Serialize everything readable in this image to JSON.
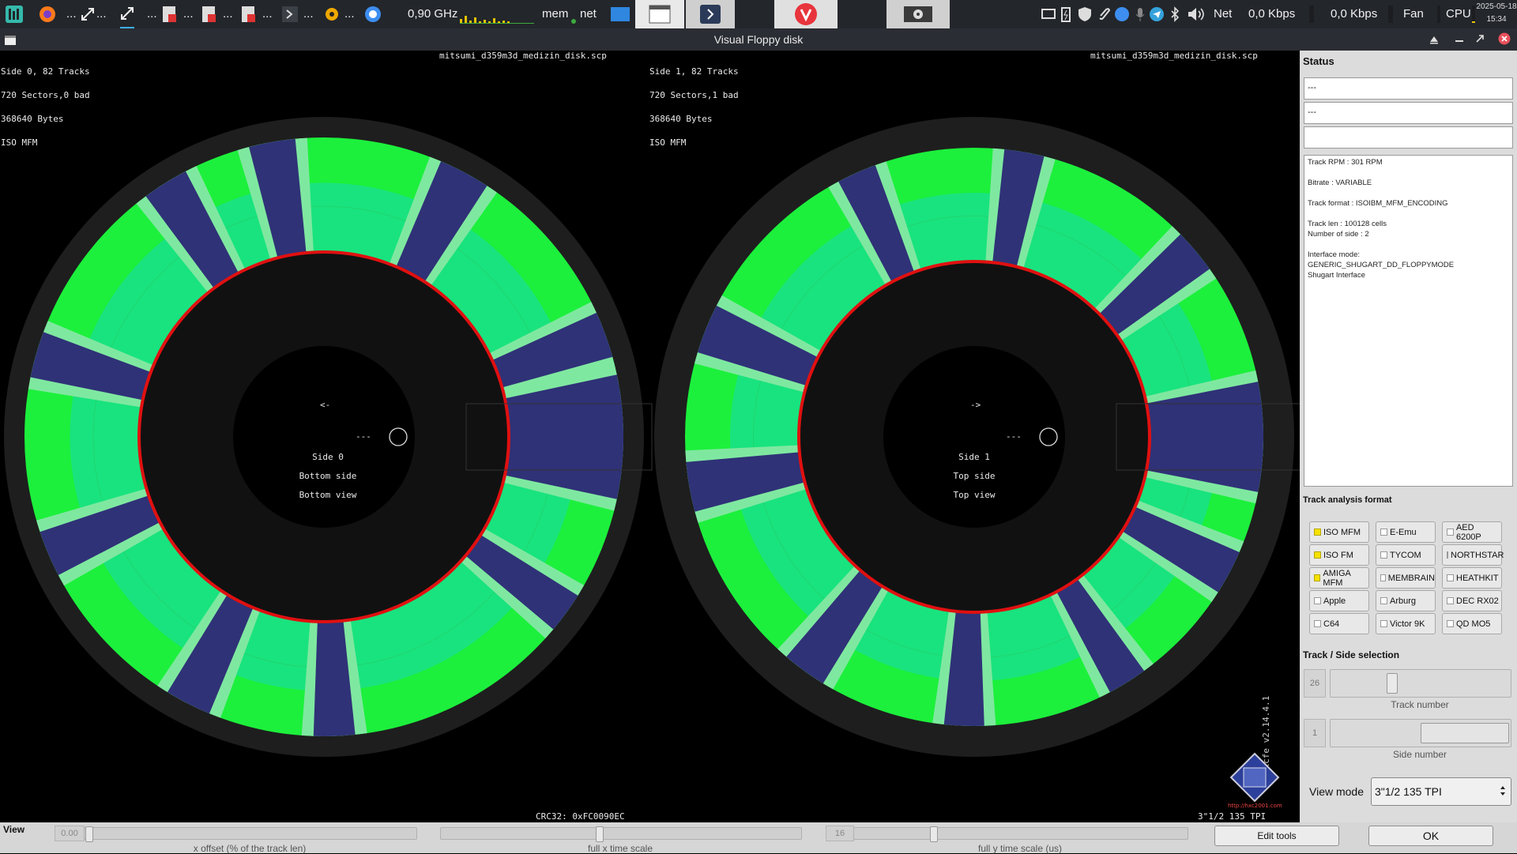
{
  "taskbar": {
    "cpu_freq": "0,90 GHz",
    "mem_label": "mem",
    "net_label": "net",
    "net_text": "Net",
    "net_down": "0,0 Kbps",
    "net_up": "0,0 Kbps",
    "fan_label": "Fan",
    "cpu_label": "CPU",
    "date": "2025-05-18",
    "time": "15:34",
    "ellipsis": "..."
  },
  "window": {
    "title": "Visual Floppy disk"
  },
  "side0": {
    "info_lines": [
      "Side 0, 82 Tracks",
      "720 Sectors,0 bad",
      "368640 Bytes",
      "ISO MFM"
    ],
    "filename": "mitsumi_d359m3d_medizin_disk.scp",
    "center_lines": [
      "Side 0",
      "Bottom side",
      "Bottom view"
    ],
    "arrow": "<-",
    "dashes": "---"
  },
  "side1": {
    "info_lines": [
      "Side 1, 82 Tracks",
      "720 Sectors,1 bad",
      "368640 Bytes",
      "ISO MFM"
    ],
    "filename": "mitsumi_d359m3d_medizin_disk.scp",
    "center_lines": [
      "Side 1",
      "Top side",
      "Top view"
    ],
    "arrow": "->",
    "dashes": "---"
  },
  "crc": "CRC32: 0xFC0090EC",
  "tpi_label": "3\"1/2 135 TPI",
  "lib_version": "libhxcfe v2.14.4.1",
  "logo_url": "http://hxc2001.com",
  "logo_text": "HxC2001",
  "status": {
    "heading": "Status",
    "field1": "---",
    "field2": "---",
    "field3": "",
    "info": [
      "Track RPM : 301 RPM",
      "",
      "Bitrate : VARIABLE",
      "",
      "Track format : ISOIBM_MFM_ENCODING",
      "",
      "Track len : 100128 cells",
      "Number of side : 2",
      "",
      "Interface mode:",
      "GENERIC_SHUGART_DD_FLOPPYMODE",
      "Shugart Interface"
    ]
  },
  "analysis": {
    "heading": "Track analysis format",
    "formats": [
      {
        "label": "ISO MFM",
        "checked": true
      },
      {
        "label": "E-Emu",
        "checked": false
      },
      {
        "label": "AED 6200P",
        "checked": false
      },
      {
        "label": "ISO FM",
        "checked": true
      },
      {
        "label": "TYCOM",
        "checked": false
      },
      {
        "label": "NORTHSTAR",
        "checked": false
      },
      {
        "label": "AMIGA MFM",
        "checked": true
      },
      {
        "label": "MEMBRAIN",
        "checked": false
      },
      {
        "label": "HEATHKIT",
        "checked": false
      },
      {
        "label": "Apple",
        "checked": false
      },
      {
        "label": "Arburg",
        "checked": false
      },
      {
        "label": "DEC RX02",
        "checked": false
      },
      {
        "label": "C64",
        "checked": false
      },
      {
        "label": "Victor 9K",
        "checked": false
      },
      {
        "label": "QD MO5",
        "checked": false
      }
    ]
  },
  "selection": {
    "heading": "Track / Side selection",
    "track_value": "26",
    "track_caption": "Track number",
    "side_value": "1",
    "side_caption": "Side number",
    "view_mode_label": "View mode",
    "view_mode_value": "3\"1/2 135 TPI"
  },
  "bottom": {
    "view_label": "View",
    "x_offset_value": "0.00",
    "x_offset_caption": "x offset (% of the track len)",
    "x_scale_caption": "full x time scale",
    "y_scale_value": "16",
    "y_scale_caption": "full y time scale (us)",
    "edit_tools": "Edit tools",
    "ok": "OK"
  }
}
